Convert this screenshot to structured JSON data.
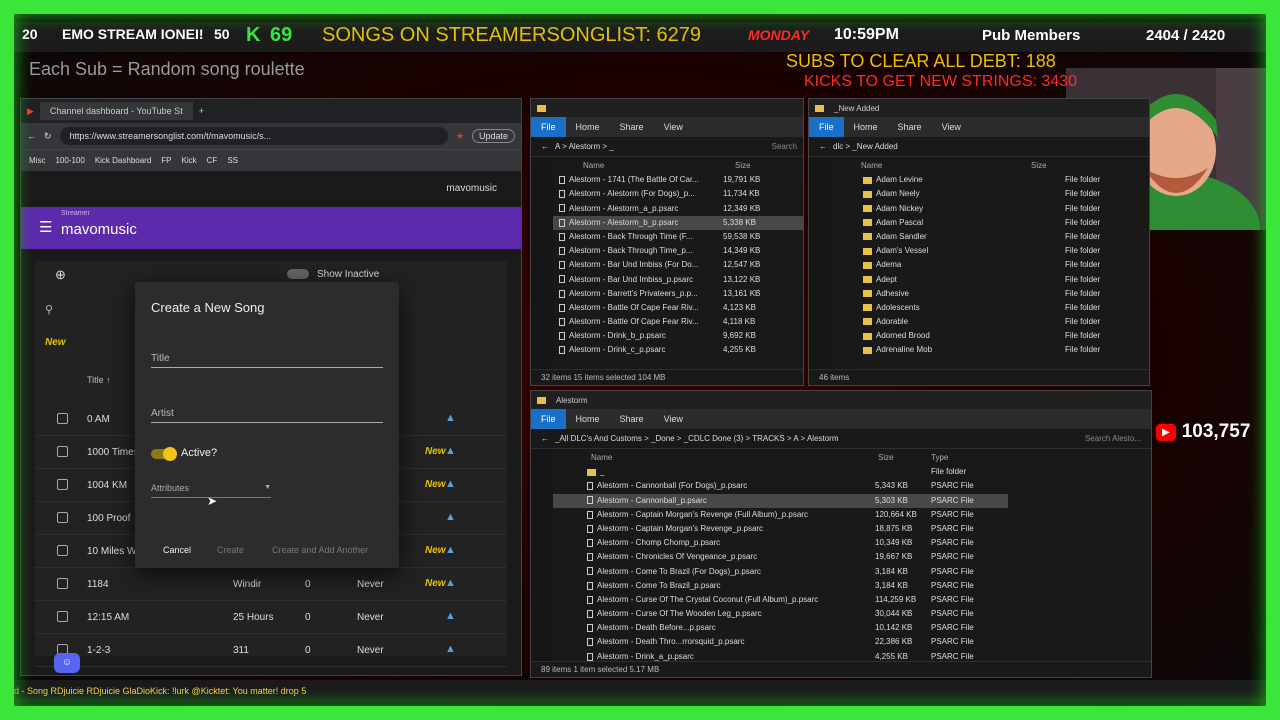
{
  "overlay": {
    "counter_left": "20",
    "emo_label": "EMO STREAM IONEI!",
    "emo_count": "50",
    "kick_count": "69",
    "songs_label": "SONGS ON STREAMERSONGLIST: 6279",
    "day": "MONDAY",
    "time": "10:59PM",
    "pub_label": "Pub Members",
    "pub_count": "2404 / 2420",
    "sub_roulette": "Each Sub = Random song roulette",
    "subs_debt": "SUBS TO CLEAR ALL DEBT: 188",
    "kicks_strings": "KICKS TO GET NEW STRINGS: 3430",
    "yt_count": "103,757",
    "ticker": "d - Song  RDjuicie RDjuicie  GlaDioKick: !lurk   @Kicktet: You matter!    drop 5"
  },
  "browser": {
    "tab_title": "Channel dashboard - YouTube St",
    "url": "https://www.streamersonglist.com/t/mavomusic/s...",
    "update_label": "Update",
    "bookmarks": [
      "Misc",
      "100-100",
      "Kick Dashboard",
      "FP",
      "Kick",
      "CF",
      "SS"
    ],
    "site_user": "mavomusic",
    "streamer_caption": "Streamer",
    "streamer_name": "mavomusic",
    "show_inactive": "Show Inactive",
    "search_placeholder": "Search",
    "new_label": "New",
    "col_title": "Title ↑",
    "rows": [
      {
        "title": "0 AM",
        "artist": "",
        "count": "",
        "last": "",
        "new": false
      },
      {
        "title": "1000 Times",
        "artist": "",
        "count": "",
        "last": "",
        "new": true
      },
      {
        "title": "1004 KM",
        "artist": "",
        "count": "",
        "last": "",
        "new": true
      },
      {
        "title": "100 Proof",
        "artist": "",
        "count": "",
        "last": "",
        "new": false
      },
      {
        "title": "10 Miles W",
        "artist": "",
        "count": "",
        "last": "",
        "new": true
      },
      {
        "title": "1184",
        "artist": "Windir",
        "count": "0",
        "last": "Never",
        "new": true
      },
      {
        "title": "12:15 AM",
        "artist": "25 Hours",
        "count": "0",
        "last": "Never",
        "new": false
      },
      {
        "title": "1-2-3",
        "artist": "311",
        "count": "0",
        "last": "Never",
        "new": false
      }
    ],
    "new_tag": "New"
  },
  "dialog": {
    "heading": "Create a New Song",
    "title_label": "Title",
    "artist_label": "Artist",
    "active_label": "Active?",
    "attributes_label": "Attributes",
    "cancel": "Cancel",
    "create": "Create",
    "create_another": "Create and Add Another"
  },
  "explorer1": {
    "path": "A   >   Alestorm   >   _",
    "search": "Search",
    "tabs": [
      "File",
      "Home",
      "Share",
      "View"
    ],
    "col_name": "Name",
    "col_size": "Size",
    "files": [
      {
        "name": "Alestorm - 1741 (The Battle Of Car...",
        "size": "19,791 KB"
      },
      {
        "name": "Alestorm - Alestorm (For Dogs)_p...",
        "size": "11,734 KB"
      },
      {
        "name": "Alestorm - Alestorm_a_p.psarc",
        "size": "12,349 KB"
      },
      {
        "name": "Alestorm - Alestorm_b_p.psarc",
        "size": "5,338 KB"
      },
      {
        "name": "Alestorm - Back Through Time (F...",
        "size": "59,538 KB"
      },
      {
        "name": "Alestorm - Back Through Time_p...",
        "size": "14,349 KB"
      },
      {
        "name": "Alestorm - Bar Und Imbiss (For Do...",
        "size": "12,547 KB"
      },
      {
        "name": "Alestorm - Bar Und Imbiss_p.psarc",
        "size": "13,122 KB"
      },
      {
        "name": "Alestorm - Barrett's Privateers_p.p...",
        "size": "13,161 KB"
      },
      {
        "name": "Alestorm - Battle Of Cape Fear Riv...",
        "size": "4,123 KB"
      },
      {
        "name": "Alestorm - Battle Of Cape Fear Riv...",
        "size": "4,118 KB"
      },
      {
        "name": "Alestorm - Drink_b_p.psarc",
        "size": "9,692 KB"
      },
      {
        "name": "Alestorm - Drink_c_p.psarc",
        "size": "4,255 KB"
      }
    ],
    "status": "32 items   15 items selected  104 MB"
  },
  "explorer2": {
    "title": "_New Added",
    "path": "dlc   >   _New Added",
    "tabs": [
      "File",
      "Home",
      "Share",
      "View"
    ],
    "col_name": "Name",
    "col_size": "Size",
    "folders": [
      "Adam Levine",
      "Adam Neely",
      "Adam Nickey",
      "Adam Pascal",
      "Adam Sandler",
      "Adam's Vessel",
      "Adema",
      "Adept",
      "Adhesive",
      "Adolescents",
      "Adorable",
      "Adorned Brood",
      "Adrenaline Mob"
    ],
    "type_label": "File folder",
    "status": "46 items"
  },
  "explorer3": {
    "title": "Alestorm",
    "path": "_All DLC's And Customs  >  _Done  >  _CDLC Done (3)  >  TRACKS  >  A  >  Alestorm",
    "search": "Search Alesto...",
    "tabs": [
      "File",
      "Home",
      "Share",
      "View"
    ],
    "col_name": "Name",
    "col_size": "Size",
    "col_type": "Type",
    "files": [
      {
        "name": "_",
        "size": "",
        "type": "File folder",
        "folder": true
      },
      {
        "name": "Alestorm - Cannonball (For Dogs)_p.psarc",
        "size": "5,343 KB",
        "type": "PSARC File"
      },
      {
        "name": "Alestorm - Cannonball_p.psarc",
        "size": "5,303 KB",
        "type": "PSARC File",
        "sel": true
      },
      {
        "name": "Alestorm - Captain Morgan's Revenge (Full Album)_p.psarc",
        "size": "120,664 KB",
        "type": "PSARC File"
      },
      {
        "name": "Alestorm - Captain Morgan's Revenge_p.psarc",
        "size": "18,875 KB",
        "type": "PSARC File"
      },
      {
        "name": "Alestorm - Chomp Chomp_p.psarc",
        "size": "10,349 KB",
        "type": "PSARC File"
      },
      {
        "name": "Alestorm - Chronicles Of Vengeance_p.psarc",
        "size": "19,667 KB",
        "type": "PSARC File"
      },
      {
        "name": "Alestorm - Come To Brazil (For Dogs)_p.psarc",
        "size": "3,184 KB",
        "type": "PSARC File"
      },
      {
        "name": "Alestorm - Come To Brazil_p.psarc",
        "size": "3,184 KB",
        "type": "PSARC File"
      },
      {
        "name": "Alestorm - Curse Of The Crystal Coconut (Full Album)_p.psarc",
        "size": "114,259 KB",
        "type": "PSARC File"
      },
      {
        "name": "Alestorm - Curse Of The Wooden Leg_p.psarc",
        "size": "30,044 KB",
        "type": "PSARC File"
      },
      {
        "name": "Alestorm - Death Before...p.psarc",
        "size": "10,142 KB",
        "type": "PSARC File"
      },
      {
        "name": "Alestorm - Death Thro...rrorsquid_p.psarc",
        "size": "22,386 KB",
        "type": "PSARC File"
      },
      {
        "name": "Alestorm - Drink_a_p.psarc",
        "size": "4,255 KB",
        "type": "PSARC File"
      }
    ],
    "status": "89 items   1 item selected  5.17 MB"
  },
  "colors": {
    "green": "#39e639",
    "accent_purple": "#5b2bab",
    "yellow": "#e6c100",
    "red": "#ff2a2a"
  }
}
